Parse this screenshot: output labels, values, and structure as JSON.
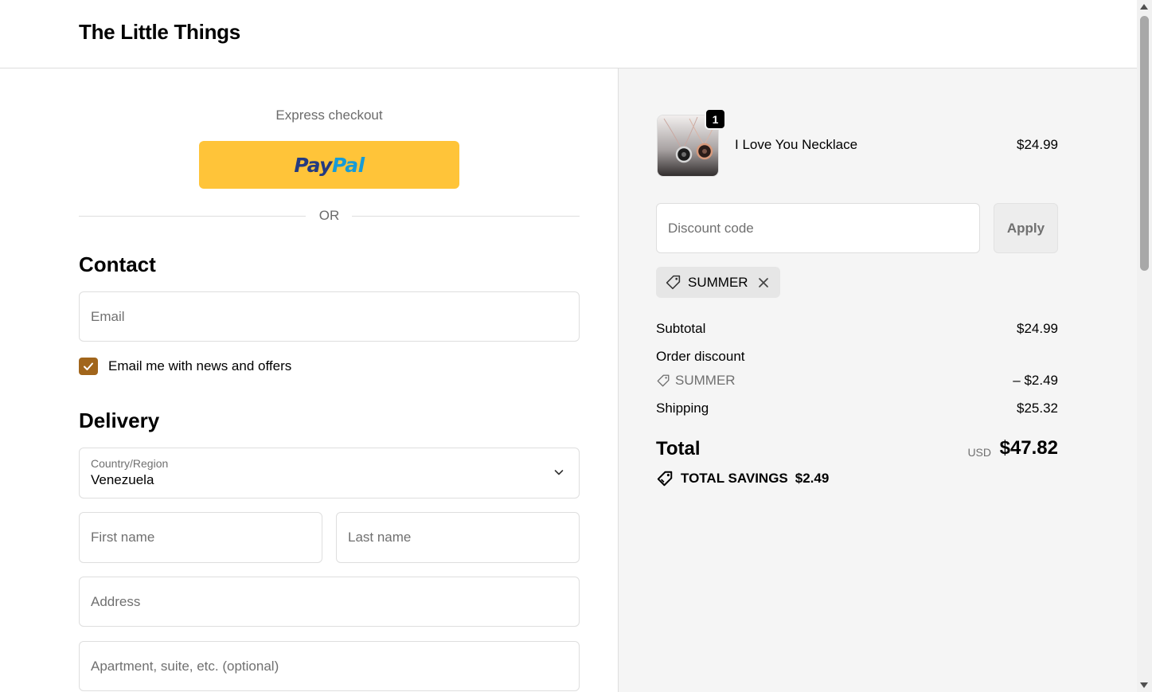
{
  "header": {
    "brand": "The Little Things"
  },
  "express": {
    "label": "Express checkout",
    "paypal_pay": "Pay",
    "paypal_pal": "Pal",
    "or_text": "OR"
  },
  "contact": {
    "title": "Contact",
    "email_placeholder": "Email",
    "newsletter_label": "Email me with news and offers",
    "newsletter_checked": true
  },
  "delivery": {
    "title": "Delivery",
    "country_label": "Country/Region",
    "country_value": "Venezuela",
    "first_name_placeholder": "First name",
    "last_name_placeholder": "Last name",
    "address_placeholder": "Address",
    "apartment_placeholder": "Apartment, suite, etc. (optional)"
  },
  "cart": {
    "item": {
      "name": "I Love You Necklace",
      "price": "$24.99",
      "quantity": "1"
    },
    "discount_placeholder": "Discount code",
    "apply_label": "Apply",
    "applied_code": "SUMMER",
    "subtotal_label": "Subtotal",
    "subtotal_value": "$24.99",
    "order_discount_label": "Order discount",
    "discount_code": "SUMMER",
    "discount_value": "– $2.49",
    "shipping_label": "Shipping",
    "shipping_value": "$25.32",
    "total_label": "Total",
    "currency": "USD",
    "total_value": "$47.82",
    "savings_label": "TOTAL SAVINGS",
    "savings_value": "$2.49"
  },
  "colors": {
    "paypal": "#ffc439",
    "checkbox": "#a1651b",
    "summary_bg": "#f5f5f5"
  },
  "icons": [
    "tag-icon",
    "close-icon",
    "chevron-down-icon",
    "checkmark-icon",
    "savings-tag-icon"
  ]
}
